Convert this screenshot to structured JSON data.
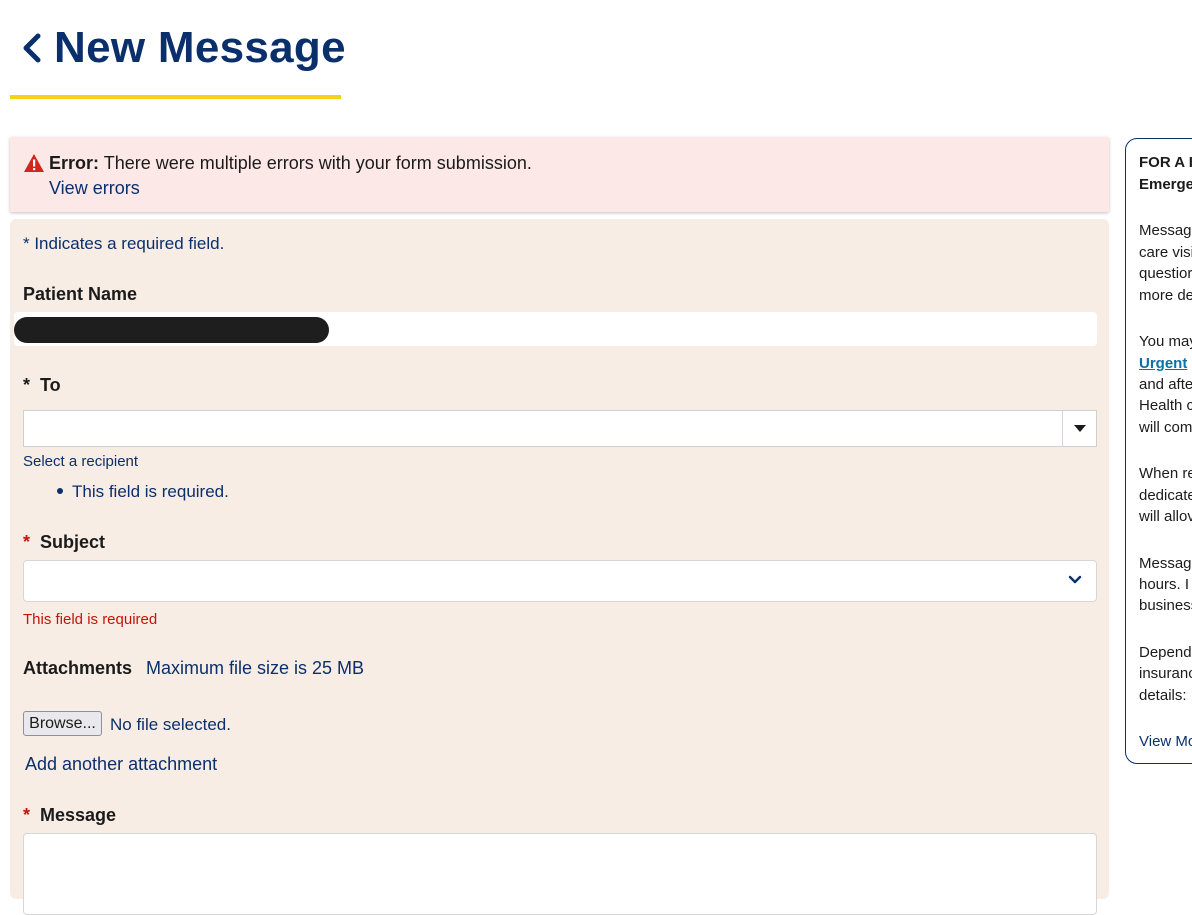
{
  "header": {
    "title": "New Message"
  },
  "error_banner": {
    "label": "Error:",
    "message": "There were multiple errors with your form submission.",
    "link": "View errors"
  },
  "form": {
    "required_note": "* Indicates a required field.",
    "patient": {
      "label": "Patient Name"
    },
    "to": {
      "star": "*",
      "label": "To",
      "value": "",
      "hint": "Select a recipient",
      "error": "This field is required."
    },
    "subject": {
      "star": "*",
      "label": "Subject",
      "value": "",
      "error": "This field is required"
    },
    "attachments": {
      "label": "Attachments",
      "max_size": "Maximum file size is 25 MB",
      "browse_label": "Browse...",
      "file_status": "No file selected.",
      "add_link": "Add another attachment"
    },
    "message": {
      "star": "*",
      "label": "Message",
      "value": ""
    }
  },
  "side_panel": {
    "lines": [
      "FOR A I",
      "Emerge",
      "Messag",
      "care visi",
      "questior",
      "more de",
      "You may",
      "Urgent",
      "and afte",
      "Health c",
      "will com",
      "When re",
      "dedicate",
      "will allov",
      "Messag",
      "hours.  I",
      "business",
      "Depend",
      "insuranc",
      "details:",
      "View Mo"
    ]
  },
  "colors": {
    "brand_navy": "#0b2f6b",
    "accent_yellow": "#f2d21b",
    "error_red": "#c0150c",
    "error_banner_bg": "#fde8e8",
    "form_bg": "#f8ede4",
    "link_teal": "#0a72a8"
  },
  "icons": {
    "back": "chevron-left-icon",
    "warning": "warning-triangle-icon",
    "to_dropdown": "caret-down-icon",
    "subject_dropdown": "chevron-down-icon"
  }
}
